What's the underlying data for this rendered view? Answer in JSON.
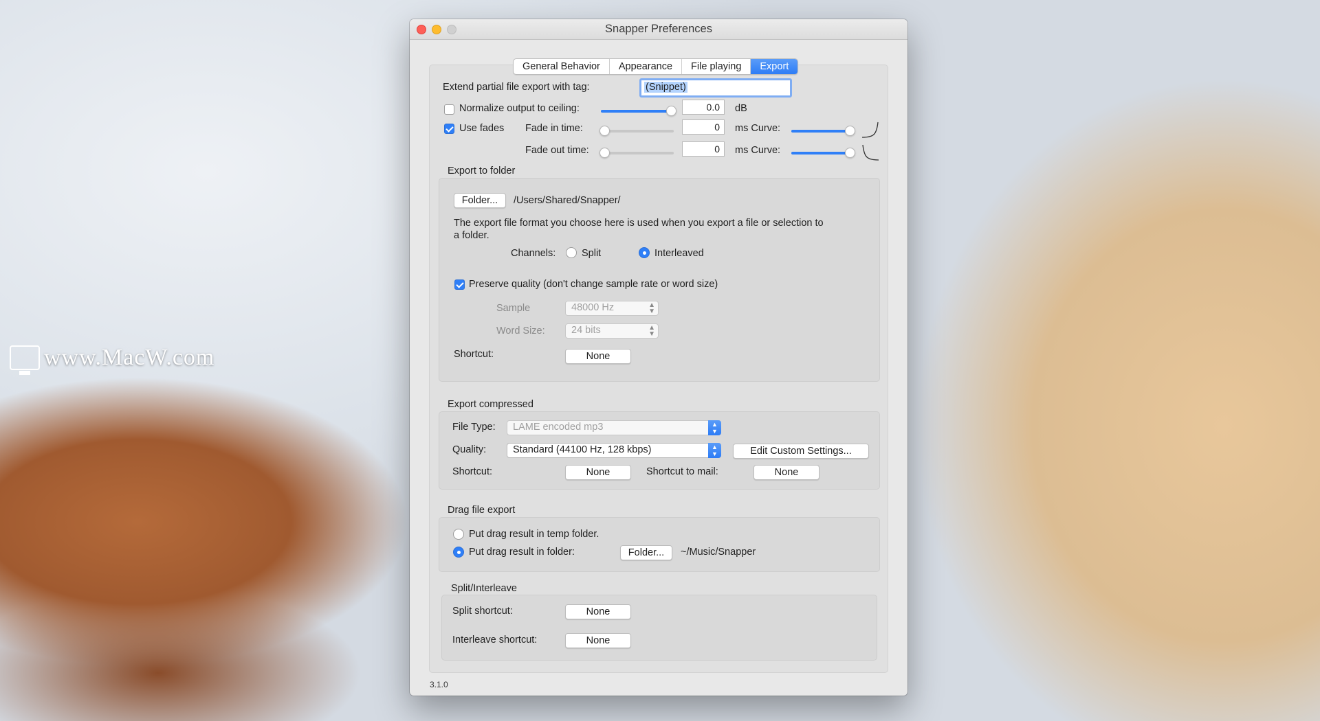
{
  "window": {
    "title": "Snapper Preferences"
  },
  "tabs": [
    "General Behavior",
    "Appearance",
    "File playing",
    "Export"
  ],
  "export_tag": {
    "label": "Extend partial file export with tag:",
    "value": "(Snippet)"
  },
  "normalize": {
    "label": "Normalize output to ceiling:",
    "checked": false,
    "value": "0.0",
    "unit": "dB",
    "level": 0.97
  },
  "fades": {
    "label": "Use fades",
    "checked": true,
    "fade_in_label": "Fade in time:",
    "fade_in_value": "0",
    "fade_out_label": "Fade out time:",
    "fade_out_value": "0",
    "ms_curve": "ms Curve:",
    "fade_in_curve_level": 1.0,
    "fade_out_curve_level": 1.0
  },
  "export_folder": {
    "header": "Export to folder",
    "folder_button": "Folder...",
    "path": "/Users/Shared/Snapper/",
    "description_1": "The export file format you choose here is used when you export a file or selection to",
    "description_2": "a folder.",
    "channels_label": "Channels:",
    "split_label": "Split",
    "interleaved_label": "Interleaved",
    "preserve_label": "Preserve quality (don't change sample rate or word size)",
    "sample_label": "Sample",
    "sample_value": "48000 Hz",
    "word_size_label": "Word Size:",
    "word_size_value": "24 bits",
    "shortcut_label": "Shortcut:",
    "shortcut_value": "None"
  },
  "export_compressed": {
    "header": "Export compressed",
    "file_type_label": "File Type:",
    "file_type_value": "LAME encoded mp3",
    "quality_label": "Quality:",
    "quality_value": "Standard (44100 Hz, 128 kbps)",
    "edit_button": "Edit Custom Settings...",
    "shortcut_label": "Shortcut:",
    "shortcut_value": "None",
    "mail_label": "Shortcut to mail:",
    "mail_value": "None"
  },
  "drag_export": {
    "header": "Drag file export",
    "temp_label": "Put drag result in temp folder.",
    "folder_label": "Put drag result in folder:",
    "folder_button": "Folder...",
    "folder_path": "~/Music/Snapper"
  },
  "split_interleave": {
    "header": "Split/Interleave",
    "split_label": "Split shortcut:",
    "split_value": "None",
    "interleave_label": "Interleave shortcut:",
    "interleave_value": "None"
  },
  "version": "3.1.0",
  "watermark": "www.MacW.com"
}
